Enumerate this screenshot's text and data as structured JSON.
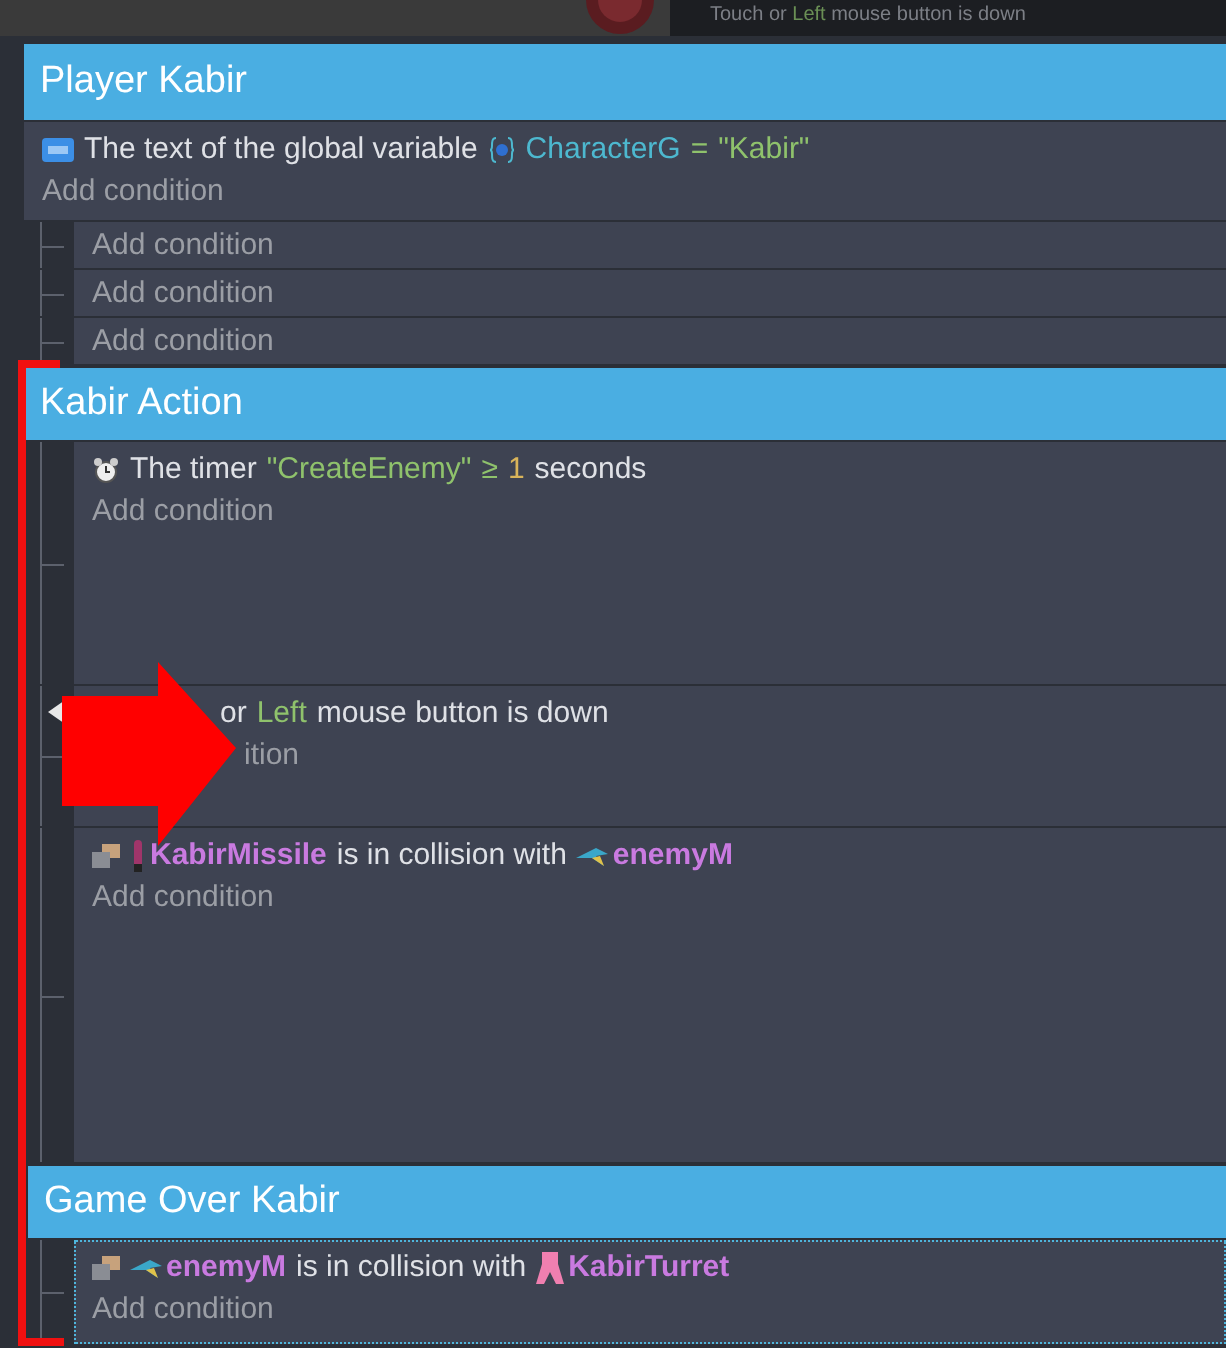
{
  "background_strip": {
    "text_parts": [
      {
        "text": "Touch or ",
        "kind": "plain"
      },
      {
        "text": "Left",
        "kind": "string"
      },
      {
        "text": " mouse button is down",
        "kind": "plain"
      }
    ]
  },
  "groups": [
    {
      "title": "Player Kabir",
      "events": [
        {
          "selected": false,
          "conditions": [
            {
              "kind": "variable",
              "parts": [
                {
                  "text": "The text of the global variable",
                  "kind": "plain"
                },
                {
                  "text": "CharacterG",
                  "kind": "variable"
                },
                {
                  "text": "=",
                  "kind": "string"
                },
                {
                  "text": "\"Kabir\"",
                  "kind": "string"
                }
              ]
            }
          ],
          "add_label": "Add condition",
          "children": [
            {
              "selected": false,
              "add_label": "Add condition"
            },
            {
              "selected": false,
              "add_label": "Add condition"
            },
            {
              "selected": false,
              "add_label": "Add condition"
            }
          ]
        }
      ]
    },
    {
      "title": "Kabir Action",
      "events": [
        {
          "selected": false,
          "conditions": [
            {
              "kind": "timer",
              "parts": [
                {
                  "text": "The timer",
                  "kind": "plain"
                },
                {
                  "text": "\"CreateEnemy\"",
                  "kind": "string"
                },
                {
                  "text": "≥",
                  "kind": "string"
                },
                {
                  "text": "1",
                  "kind": "number"
                },
                {
                  "text": "seconds",
                  "kind": "plain"
                }
              ]
            }
          ],
          "add_label": "Add condition"
        },
        {
          "selected": false,
          "conditions": [
            {
              "kind": "input",
              "parts": [
                {
                  "text": "or",
                  "kind": "plain"
                },
                {
                  "text": "Left",
                  "kind": "string"
                },
                {
                  "text": "mouse button is down",
                  "kind": "plain"
                }
              ]
            }
          ],
          "add_label": "ition"
        },
        {
          "selected": false,
          "conditions": [
            {
              "kind": "collision",
              "parts": [
                {
                  "text": "KabirMissile",
                  "kind": "object"
                },
                {
                  "text": "is in collision with",
                  "kind": "plain"
                },
                {
                  "text": "enemyM",
                  "kind": "object"
                }
              ]
            }
          ],
          "add_label": "Add condition"
        }
      ]
    },
    {
      "title": "Game Over Kabir",
      "events": [
        {
          "selected": true,
          "conditions": [
            {
              "kind": "collision",
              "parts": [
                {
                  "text": "enemyM",
                  "kind": "object"
                },
                {
                  "text": "is in collision with",
                  "kind": "plain"
                },
                {
                  "text": "KabirTurret",
                  "kind": "object"
                }
              ]
            }
          ],
          "add_label": "Add condition"
        }
      ]
    }
  ]
}
